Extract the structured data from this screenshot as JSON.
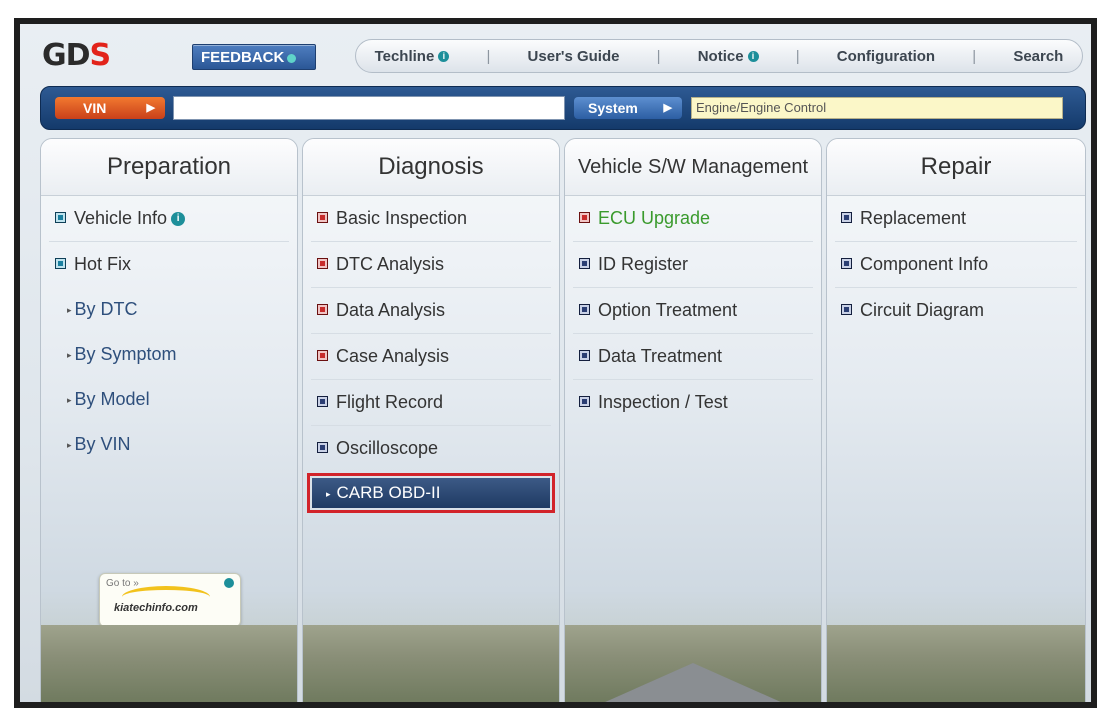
{
  "header": {
    "logo_text": "GD",
    "logo_mark": "S",
    "feedback_label": "FEEDBACK",
    "nav": [
      {
        "label": "Techline",
        "has_info": true
      },
      {
        "label": "User's Guide",
        "has_info": false
      },
      {
        "label": "Notice",
        "has_info": true
      },
      {
        "label": "Configuration",
        "has_info": false
      },
      {
        "label": "Search",
        "has_info": false
      }
    ],
    "info_glyph": "i"
  },
  "vinbar": {
    "vin_label": "VIN",
    "vin_value": "",
    "system_label": "System",
    "system_value": "Engine/Engine Control",
    "arrow": "▶"
  },
  "columns": {
    "preparation": {
      "title": "Preparation",
      "items": [
        "Vehicle Info",
        "Hot Fix"
      ],
      "sub_items": [
        "By DTC",
        "By Symptom",
        "By Model",
        "By VIN"
      ]
    },
    "diagnosis": {
      "title": "Diagnosis",
      "items": [
        "Basic Inspection",
        "DTC Analysis",
        "Data Analysis",
        "Case Analysis",
        "Flight Record",
        "Oscilloscope"
      ],
      "highlighted": "CARB OBD-II"
    },
    "swmgmt": {
      "title": "Vehicle S/W Management",
      "items": [
        "ECU Upgrade",
        "ID Register",
        "Option Treatment",
        "Data Treatment",
        "Inspection / Test"
      ]
    },
    "repair": {
      "title": "Repair",
      "items": [
        "Replacement",
        "Component Info",
        "Circuit Diagram"
      ]
    }
  },
  "promo": {
    "goto_label": "Go to »",
    "site": "kiatechinfo.com"
  },
  "colors": {
    "accent_red": "#d2232a",
    "nav_blue": "#1f3a63",
    "teal": "#1a7f9f",
    "green_text": "#3a9a2d"
  }
}
